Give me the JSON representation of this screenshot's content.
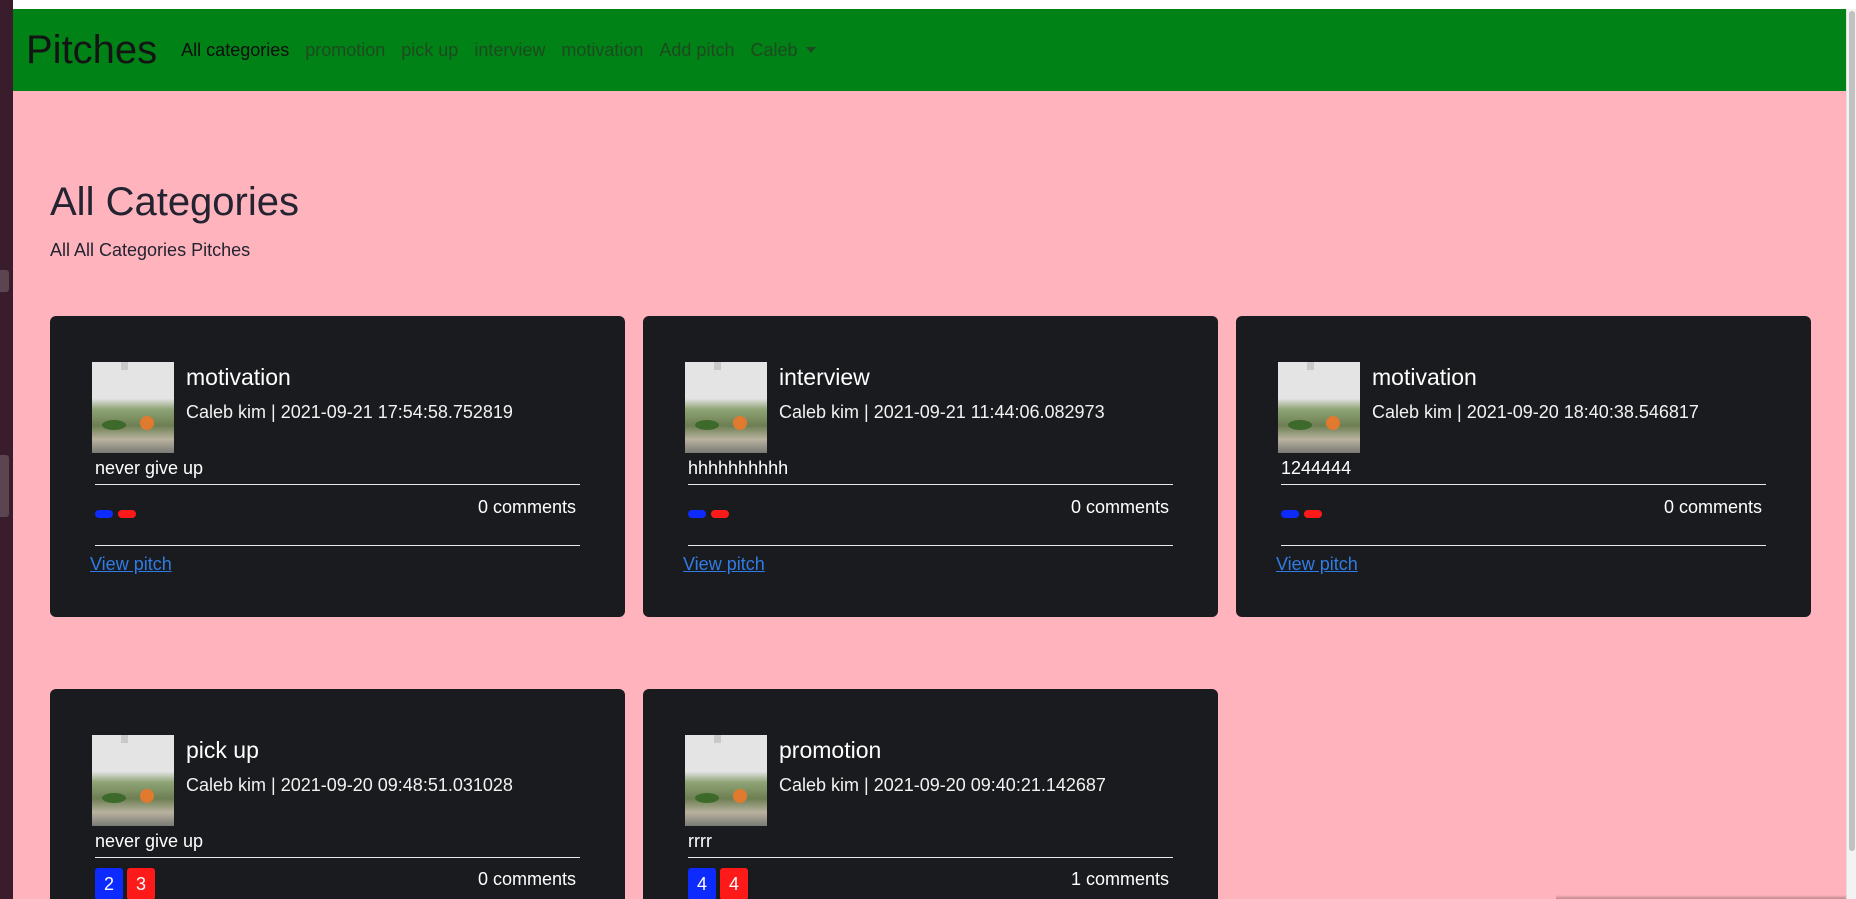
{
  "navbar": {
    "brand": "Pitches",
    "links": [
      {
        "label": "All categories",
        "active": true
      },
      {
        "label": "promotion"
      },
      {
        "label": "pick up"
      },
      {
        "label": "interview"
      },
      {
        "label": "motivation"
      },
      {
        "label": "Add pitch"
      }
    ],
    "user_menu": "Caleb"
  },
  "header": {
    "title": "All Categories",
    "subtitle": "All All Categories Pitches"
  },
  "pitches": [
    {
      "category": "motivation",
      "meta": "Caleb kim | 2021-09-21 17:54:58.752819",
      "body": "never give up",
      "upvotes": "",
      "downvotes": "",
      "comments": "0 comments",
      "link": "View pitch"
    },
    {
      "category": "interview",
      "meta": "Caleb kim | 2021-09-21 11:44:06.082973",
      "body": "hhhhhhhhhh",
      "upvotes": "",
      "downvotes": "",
      "comments": "0 comments",
      "link": "View pitch"
    },
    {
      "category": "motivation",
      "meta": "Caleb kim | 2021-09-20 18:40:38.546817",
      "body": "1244444",
      "upvotes": "",
      "downvotes": "",
      "comments": "0 comments",
      "link": "View pitch"
    },
    {
      "category": "pick up",
      "meta": "Caleb kim | 2021-09-20 09:48:51.031028",
      "body": "never give up",
      "upvotes": "2",
      "downvotes": "3",
      "comments": "0 comments"
    },
    {
      "category": "promotion",
      "meta": "Caleb kim | 2021-09-20 09:40:21.142687",
      "body": "rrrr",
      "upvotes": "4",
      "downvotes": "4",
      "comments": "1 comments"
    }
  ],
  "colors": {
    "navbar": "#008217",
    "page_background": "#ffb3bd",
    "card": "#1a1b1e",
    "upvote": "#0d2bff",
    "downvote": "#ff1a1a",
    "link": "#2f7ce6"
  }
}
